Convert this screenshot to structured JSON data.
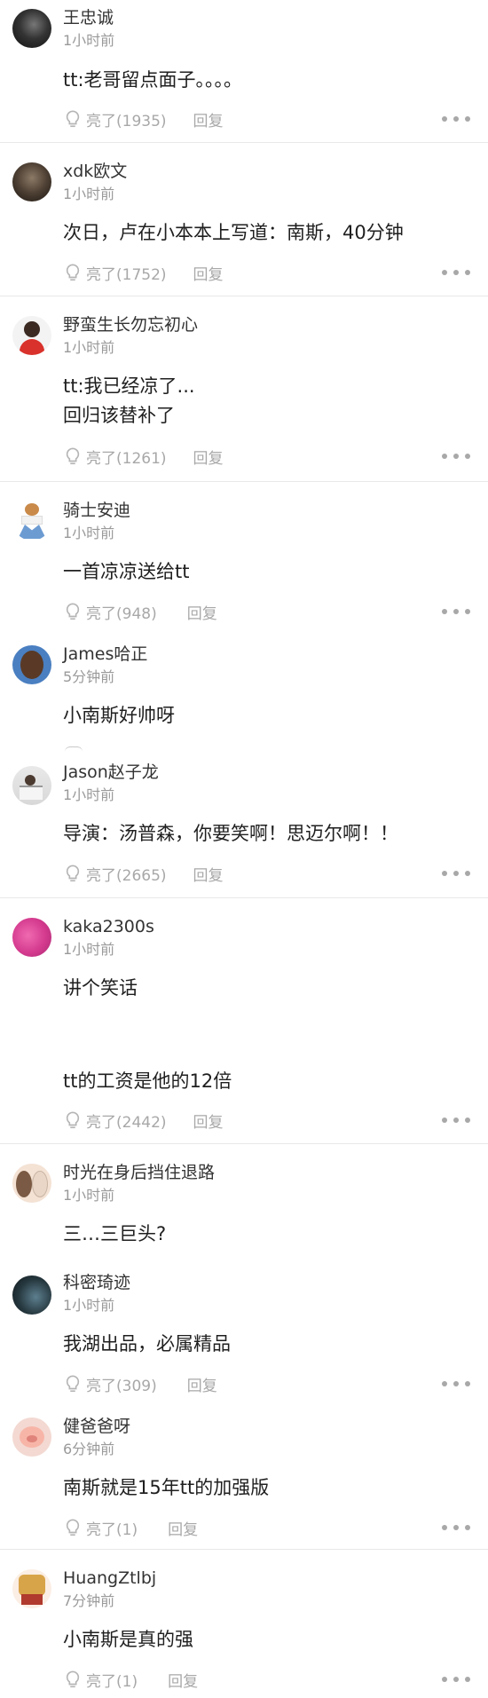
{
  "comments": [
    {
      "name": "王忠诚",
      "time": "1小时前",
      "lines": [
        "tt:老哥留点面子。。。。"
      ],
      "likes": "亮了(1935)",
      "reply": "回复"
    },
    {
      "name": "xdk欧文",
      "time": "1小时前",
      "lines": [
        "次日，卢在小本本上写道：南斯，40分钟"
      ],
      "likes": "亮了(1752)",
      "reply": "回复"
    },
    {
      "name": "野蛮生长勿忘初心",
      "time": "1小时前",
      "lines": [
        "tt:我已经凉了...",
        "回归该替补了"
      ],
      "likes": "亮了(1261)",
      "reply": "回复"
    },
    {
      "name": "骑士安迪",
      "time": "1小时前",
      "lines": [
        "一首凉凉送给tt"
      ],
      "likes": "亮了(948)",
      "reply": "回复"
    },
    {
      "name": "James哈正",
      "time": "5分钟前",
      "lines": [
        "小南斯好帅呀"
      ]
    },
    {
      "name": "Jason赵子龙",
      "time": "1小时前",
      "lines": [
        "导演：汤普森，你要笑啊！思迈尔啊！！"
      ],
      "likes": "亮了(2665)",
      "reply": "回复"
    },
    {
      "name": "kaka2300s",
      "time": "1小时前",
      "lines": [
        "讲个笑话",
        "tt的工资是他的12倍"
      ],
      "likes": "亮了(2442)",
      "reply": "回复"
    },
    {
      "name": "时光在身后挡住退路",
      "time": "1小时前",
      "lines": [
        "三…三巨头?"
      ]
    },
    {
      "name": "科密琦迹",
      "time": "1小时前",
      "lines": [
        "我湖出品，必属精品"
      ],
      "likes": "亮了(309)",
      "reply": "回复"
    },
    {
      "name": "健爸爸呀",
      "time": "6分钟前",
      "lines": [
        "南斯就是15年tt的加强版"
      ],
      "likes": "亮了(1)",
      "reply": "回复"
    },
    {
      "name": "HuangZtlbj",
      "time": "7分钟前",
      "lines": [
        "小南斯是真的强"
      ],
      "likes": "亮了(1)",
      "reply": "回复"
    }
  ],
  "icons": {
    "like": "lightbulb-icon",
    "more": "more-dots-icon"
  },
  "colors": {
    "text_primary": "#1f1f1f",
    "text_muted": "#9a9a9a",
    "divider": "#e8e8e8"
  }
}
